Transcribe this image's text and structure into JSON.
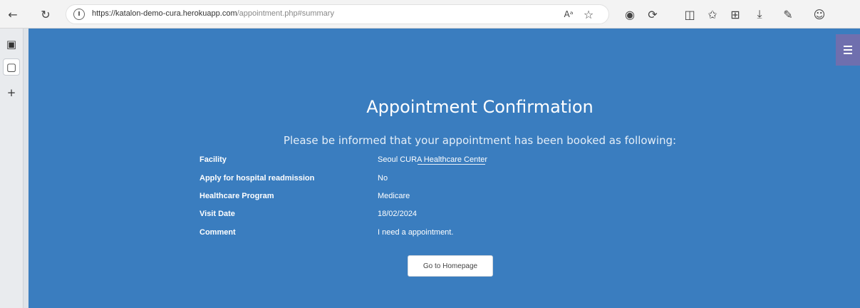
{
  "browser": {
    "url_host": "https://katalon-demo-cura.herokuapp.com",
    "url_path": "/appointment.php#summary",
    "icons": [
      "back-icon",
      "refresh-icon",
      "read-aloud-icon",
      "favorite-icon",
      "extension-icon",
      "profile-icon"
    ]
  },
  "page": {
    "title": "Appointment Confirmation",
    "subtitle": "Please be informed that your appointment has been booked as following:",
    "details": [
      {
        "label": "Facility",
        "value": "Seoul CURA Healthcare Center"
      },
      {
        "label": "Apply for hospital readmission",
        "value": "No"
      },
      {
        "label": "Healthcare Program",
        "value": "Medicare"
      },
      {
        "label": "Visit Date",
        "value": "18/02/2024"
      },
      {
        "label": "Comment",
        "value": "I need a appointment."
      }
    ],
    "home_button": "Go to Homepage"
  },
  "colors": {
    "page_bg": "#3a7dbf",
    "menu_toggle_bg": "#6f6fae",
    "text": "#ffffff"
  }
}
